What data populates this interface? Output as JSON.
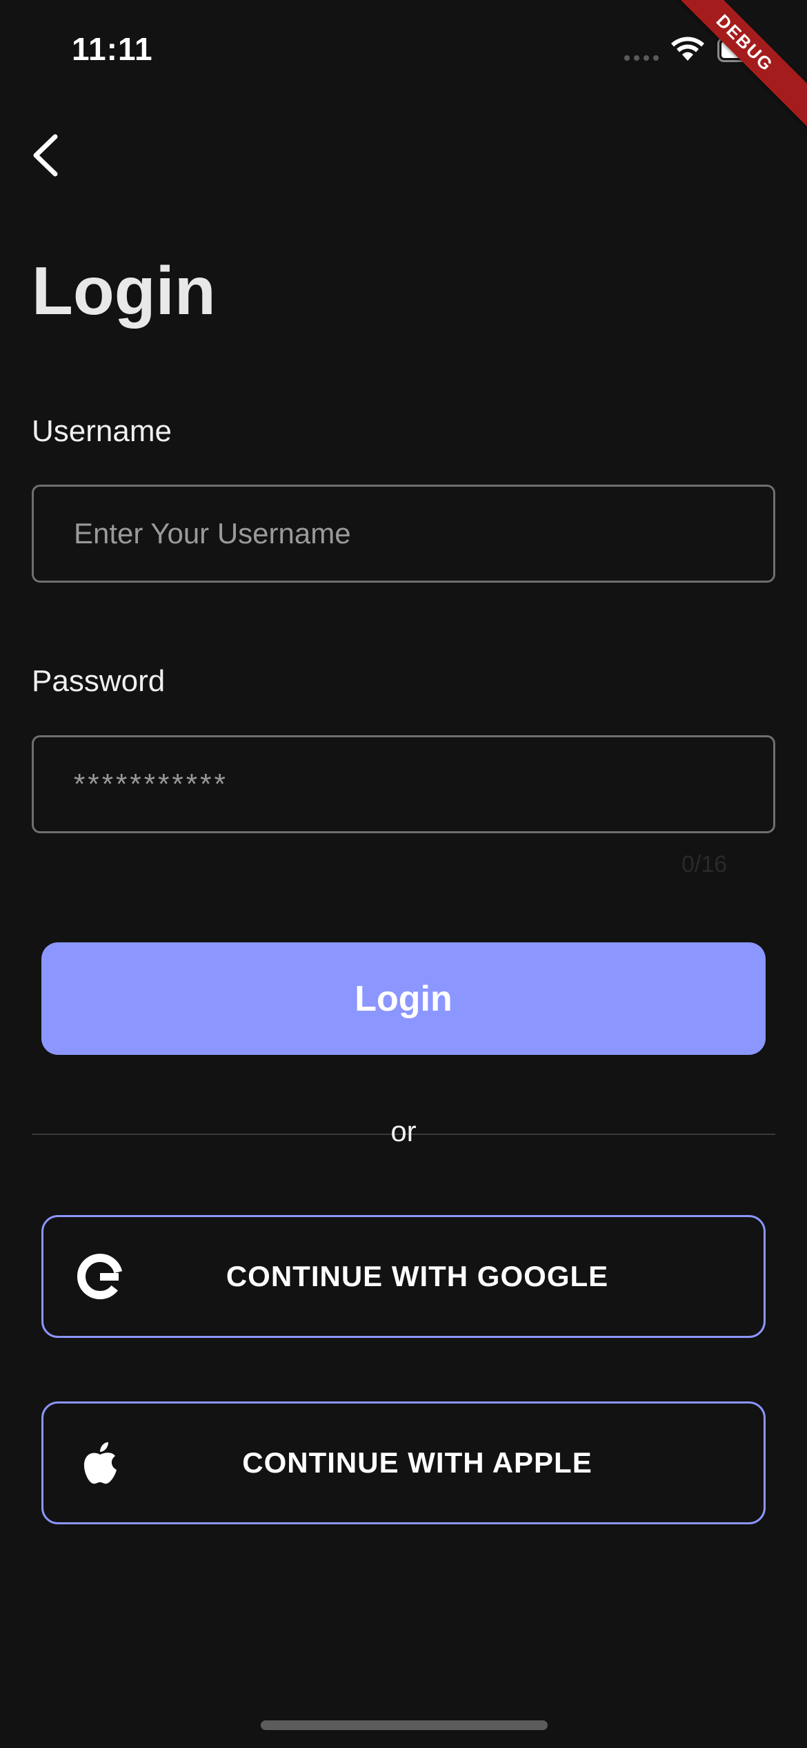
{
  "status_bar": {
    "time": "11:11"
  },
  "debug_banner": {
    "label": "DEBUG"
  },
  "page": {
    "title": "Login"
  },
  "username": {
    "label": "Username",
    "placeholder": "Enter Your Username",
    "value": ""
  },
  "password": {
    "label": "Password",
    "placeholder": "***********",
    "value": "",
    "counter": "0/16"
  },
  "login_button": {
    "label": "Login"
  },
  "divider": {
    "label": "or"
  },
  "social": {
    "google_label": "CONTINUE WITH GOOGLE",
    "apple_label": "CONTINUE WITH APPLE"
  },
  "colors": {
    "background": "#121212",
    "accent": "#8c96ff",
    "input_border": "#6f6f6f",
    "debug_banner": "#a51c1c"
  },
  "icons": [
    "back-arrow-icon",
    "wifi-icon",
    "battery-icon",
    "google-icon",
    "apple-icon"
  ]
}
